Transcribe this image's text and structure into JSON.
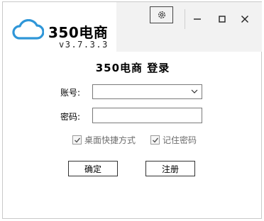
{
  "app": {
    "name": "350电商",
    "version": "v3.7.3.3"
  },
  "login": {
    "title": "350电商  登录",
    "account_label": "账号:",
    "account_value": "",
    "password_label": "密码:",
    "password_value": "",
    "remember_desktop_label": "桌面快捷方式",
    "remember_desktop_checked": true,
    "remember_password_label": "记住密码",
    "remember_password_checked": true,
    "confirm_label": "确定",
    "register_label": "注册"
  },
  "icons": {
    "logo": "cloud-icon",
    "settings": "gear-icon",
    "minimize": "minimize-icon",
    "maximize": "maximize-icon",
    "close": "close-icon",
    "dropdown": "chevron-down-icon",
    "check": "check-icon"
  },
  "colors": {
    "brand_blue": "#2f96d8"
  }
}
